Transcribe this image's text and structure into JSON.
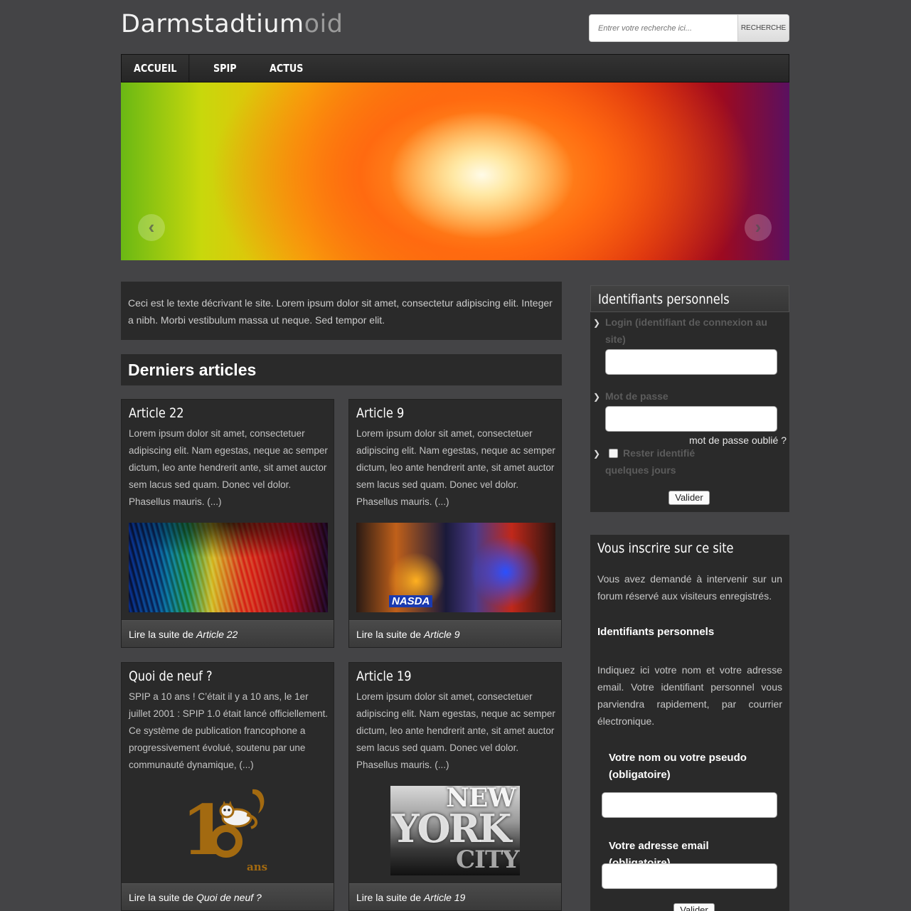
{
  "site": {
    "title_main": "Darmstadtium",
    "title_suffix": "oid"
  },
  "search": {
    "placeholder": "Entrer votre recherche ici...",
    "button": "RECHERCHE"
  },
  "nav": {
    "items": [
      "ACCUEIL",
      "SPIP",
      "ACTUS"
    ]
  },
  "banner": {
    "prev": "‹",
    "next": "›"
  },
  "intro": {
    "text": "Ceci est le texte décrivant le site. Lorem ipsum dolor sit amet, consectetur adipiscing elit. Integer a nibh. Morbi vestibulum massa ut neque. Sed tempor elit."
  },
  "articles": {
    "heading": "Derniers articles",
    "read_more_prefix": "Lire la suite de ",
    "items": [
      {
        "title": "Article 22",
        "excerpt": "Lorem ipsum dolor sit amet, consectetuer adipiscing elit. Nam egestas, neque ac semper dictum, leo ante hendrerit ante, sit amet auctor sem lacus sed quam. Donec vel dolor. Phasellus mauris. (...)",
        "link_title": "Article 22"
      },
      {
        "title": "Article 9",
        "excerpt": "Lorem ipsum dolor sit amet, consectetuer adipiscing elit. Nam egestas, neque ac semper dictum, leo ante hendrerit ante, sit amet auctor sem lacus sed quam. Donec vel dolor. Phasellus mauris. (...)",
        "link_title": "Article 9",
        "image_tag": "NASDA"
      },
      {
        "title": "Quoi de neuf ?",
        "excerpt": "SPIP a 10 ans ! C’était il y a 10 ans, le 1er juillet 2001 : SPIP 1.0 était lancé officiellement. Ce système de publication francophone a progressivement évolué, soutenu par une communauté dynamique, (...)",
        "link_title": "Quoi de neuf ?",
        "logo_number_one": "1",
        "logo_text": "ans"
      },
      {
        "title": "Article 19",
        "excerpt": "Lorem ipsum dolor sit amet, consectetuer adipiscing elit. Nam egestas, neque ac semper dictum, leo ante hendrerit ante, sit amet auctor sem lacus sed quam. Donec vel dolor. Phasellus mauris. (...)",
        "link_title": "Article 19",
        "image_words": [
          "NEW",
          "YORK",
          "CITY"
        ]
      }
    ]
  },
  "login": {
    "heading": "Identifiants personnels",
    "login_label": "Login (identifiant de connexion au site)",
    "password_label": "Mot de passe",
    "forgot": "mot de passe oublié ?",
    "remember": "Rester identifié quelques jours",
    "submit": "Valider"
  },
  "register": {
    "heading": "Vous inscrire sur ce site",
    "intro": "Vous avez demandé à intervenir sur un forum réservé aux visiteurs enregistrés.",
    "subheading": "Identifiants personnels",
    "help": "Indiquez ici votre nom et votre adresse email. Votre identifiant personnel vous parviendra rapidement, par courrier électronique.",
    "name_label": "Votre nom ou votre pseudo (obligatoire)",
    "email_label": "Votre adresse email (obligatoire)",
    "submit": "Valider"
  },
  "colors": {
    "background": "#444446",
    "panel": "#2a2a2a",
    "logo_brown": "#a36a10"
  },
  "icons": {
    "arrow": "chevron-right-icon",
    "prev": "chevron-left-icon",
    "next": "chevron-right-icon"
  }
}
